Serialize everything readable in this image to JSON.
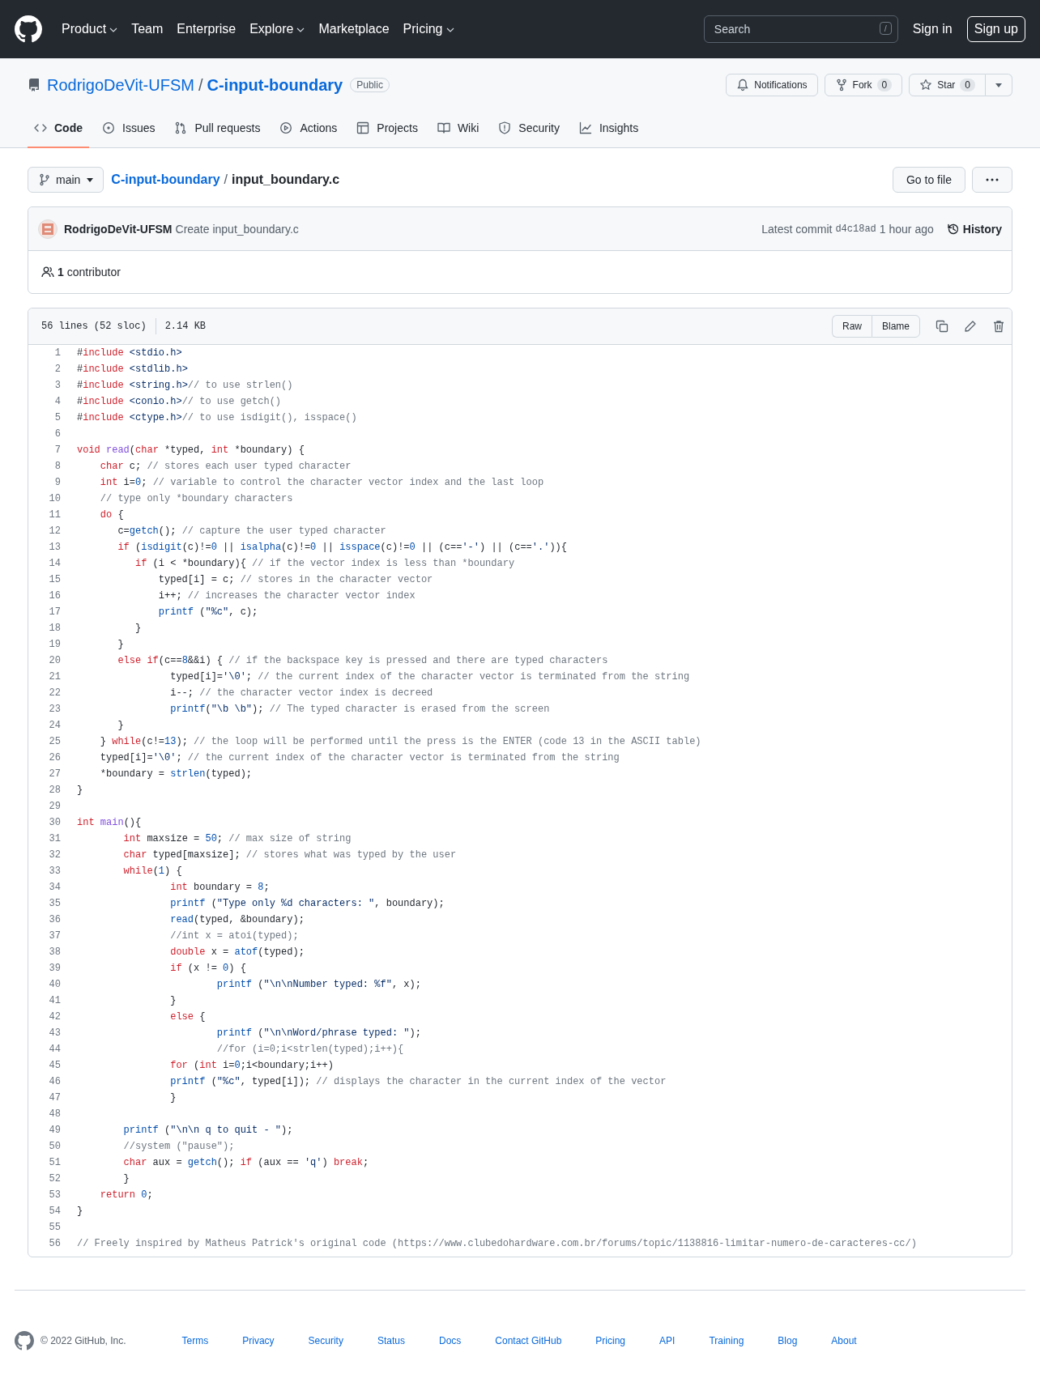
{
  "header": {
    "nav": [
      {
        "label": "Product",
        "dropdown": true
      },
      {
        "label": "Team",
        "dropdown": false
      },
      {
        "label": "Enterprise",
        "dropdown": false
      },
      {
        "label": "Explore",
        "dropdown": true
      },
      {
        "label": "Marketplace",
        "dropdown": false
      },
      {
        "label": "Pricing",
        "dropdown": true
      }
    ],
    "search": {
      "placeholder": "Search",
      "shortcut": "/"
    },
    "sign_in": "Sign in",
    "sign_up": "Sign up"
  },
  "repo": {
    "owner": "RodrigoDeVit-UFSM",
    "separator": "/",
    "name": "C-input-boundary",
    "visibility": "Public",
    "notifications": "Notifications",
    "fork": {
      "label": "Fork",
      "count": "0"
    },
    "star": {
      "label": "Star",
      "count": "0"
    }
  },
  "tabs": [
    {
      "label": "Code",
      "selected": true
    },
    {
      "label": "Issues",
      "selected": false
    },
    {
      "label": "Pull requests",
      "selected": false
    },
    {
      "label": "Actions",
      "selected": false
    },
    {
      "label": "Projects",
      "selected": false
    },
    {
      "label": "Wiki",
      "selected": false
    },
    {
      "label": "Security",
      "selected": false
    },
    {
      "label": "Insights",
      "selected": false
    }
  ],
  "breadcrumb": {
    "branch": "main",
    "repo": "C-input-boundary",
    "separator": "/",
    "file": "input_boundary.c",
    "go_to_file": "Go to file"
  },
  "commit": {
    "author": "RodrigoDeVit-UFSM",
    "message": "Create input_boundary.c",
    "latest_label": "Latest commit",
    "sha": "d4c18ad",
    "time": "1 hour ago",
    "history": "History"
  },
  "contributors": {
    "count": "1",
    "label": "contributor"
  },
  "file": {
    "lines_info": "56 lines (52 sloc)",
    "size": "2.14 KB",
    "buttons": [
      "Raw",
      "Blame"
    ],
    "lines": [
      {
        "n": "1",
        "t": [
          {
            "kind": "plain",
            "text": "#"
          },
          {
            "kind": "keyword",
            "text": "include"
          },
          {
            "kind": "string",
            "text": " <stdio.h>"
          }
        ]
      },
      {
        "n": "2",
        "t": [
          {
            "kind": "plain",
            "text": "#"
          },
          {
            "kind": "keyword",
            "text": "include"
          },
          {
            "kind": "string",
            "text": " <stdlib.h>"
          }
        ]
      },
      {
        "n": "3",
        "t": [
          {
            "kind": "plain",
            "text": "#"
          },
          {
            "kind": "keyword",
            "text": "include"
          },
          {
            "kind": "string",
            "text": " <string.h>"
          },
          {
            "kind": "comment",
            "text": "// to use strlen()"
          }
        ]
      },
      {
        "n": "4",
        "t": [
          {
            "kind": "plain",
            "text": "#"
          },
          {
            "kind": "keyword",
            "text": "include"
          },
          {
            "kind": "string",
            "text": " <conio.h>"
          },
          {
            "kind": "comment",
            "text": "// to use getch()"
          }
        ]
      },
      {
        "n": "5",
        "t": [
          {
            "kind": "plain",
            "text": "#"
          },
          {
            "kind": "keyword",
            "text": "include"
          },
          {
            "kind": "string",
            "text": " <ctype.h>"
          },
          {
            "kind": "comment",
            "text": "// to use isdigit(), isspace()"
          }
        ]
      },
      {
        "n": "6"
      },
      {
        "n": "7",
        "t": [
          {
            "kind": "keyword",
            "text": "void "
          },
          {
            "kind": "def",
            "text": "read"
          },
          {
            "kind": "plain",
            "text": "("
          },
          {
            "kind": "keyword",
            "text": "char"
          },
          {
            "kind": "plain",
            "text": " *typed, "
          },
          {
            "kind": "keyword",
            "text": "int"
          },
          {
            "kind": "plain",
            "text": " *boundary) {"
          }
        ]
      },
      {
        "n": "8",
        "t": [
          {
            "kind": "keyword",
            "text": "    char"
          },
          {
            "kind": "plain",
            "text": " c; "
          },
          {
            "kind": "comment",
            "text": "// stores each user typed character"
          }
        ]
      },
      {
        "n": "9",
        "t": [
          {
            "kind": "keyword",
            "text": "    int"
          },
          {
            "kind": "plain",
            "text": " i="
          },
          {
            "kind": "number",
            "text": "0"
          },
          {
            "kind": "plain",
            "text": "; "
          },
          {
            "kind": "comment",
            "text": "// variable to control the character vector index and the last loop"
          }
        ]
      },
      {
        "n": "10",
        "t": [
          {
            "kind": "comment",
            "text": "    // type only *boundary characters"
          }
        ]
      },
      {
        "n": "11",
        "t": [
          {
            "kind": "keyword",
            "text": "    do"
          },
          {
            "kind": "plain",
            "text": " {"
          }
        ]
      },
      {
        "n": "12",
        "t": [
          {
            "kind": "plain",
            "text": "       c="
          },
          {
            "kind": "call",
            "text": "getch"
          },
          {
            "kind": "plain",
            "text": "(); "
          },
          {
            "kind": "comment",
            "text": "// capture the user typed character"
          }
        ]
      },
      {
        "n": "13",
        "t": [
          {
            "kind": "keyword",
            "text": "       if"
          },
          {
            "kind": "plain",
            "text": " ("
          },
          {
            "kind": "call",
            "text": "isdigit"
          },
          {
            "kind": "plain",
            "text": "(c)!="
          },
          {
            "kind": "number",
            "text": "0"
          },
          {
            "kind": "plain",
            "text": " || "
          },
          {
            "kind": "call",
            "text": "isalpha"
          },
          {
            "kind": "plain",
            "text": "(c)!="
          },
          {
            "kind": "number",
            "text": "0"
          },
          {
            "kind": "plain",
            "text": " || "
          },
          {
            "kind": "call",
            "text": "isspace"
          },
          {
            "kind": "plain",
            "text": "(c)!="
          },
          {
            "kind": "number",
            "text": "0"
          },
          {
            "kind": "plain",
            "text": " || (c=="
          },
          {
            "kind": "string",
            "text": "'-'"
          },
          {
            "kind": "plain",
            "text": ") || (c=="
          },
          {
            "kind": "string",
            "text": "'.'"
          },
          {
            "kind": "plain",
            "text": ")){"
          }
        ]
      },
      {
        "n": "14",
        "t": [
          {
            "kind": "keyword",
            "text": "          if"
          },
          {
            "kind": "plain",
            "text": " (i < *boundary){ "
          },
          {
            "kind": "comment",
            "text": "// if the vector index is less than *boundary"
          }
        ]
      },
      {
        "n": "15",
        "t": [
          {
            "kind": "plain",
            "text": "              typed[i] = c; "
          },
          {
            "kind": "comment",
            "text": "// stores in the character vector"
          }
        ]
      },
      {
        "n": "16",
        "t": [
          {
            "kind": "plain",
            "text": "              i++; "
          },
          {
            "kind": "comment",
            "text": "// increases the character vector index"
          }
        ]
      },
      {
        "n": "17",
        "t": [
          {
            "kind": "call",
            "text": "              printf"
          },
          {
            "kind": "plain",
            "text": " ("
          },
          {
            "kind": "string",
            "text": "\"%c\""
          },
          {
            "kind": "plain",
            "text": ", c);"
          }
        ]
      },
      {
        "n": "18",
        "t": [
          {
            "kind": "plain",
            "text": "          }"
          }
        ]
      },
      {
        "n": "19",
        "t": [
          {
            "kind": "plain",
            "text": "       }"
          }
        ]
      },
      {
        "n": "20",
        "t": [
          {
            "kind": "keyword",
            "text": "       else if"
          },
          {
            "kind": "plain",
            "text": "(c=="
          },
          {
            "kind": "number",
            "text": "8"
          },
          {
            "kind": "plain",
            "text": "&&i) { "
          },
          {
            "kind": "comment",
            "text": "// if the backspace key is pressed and there are typed characters"
          }
        ]
      },
      {
        "n": "21",
        "t": [
          {
            "kind": "plain",
            "text": "                typed[i]="
          },
          {
            "kind": "string",
            "text": "'\\0'"
          },
          {
            "kind": "plain",
            "text": "; "
          },
          {
            "kind": "comment",
            "text": "// the current index of the character vector is terminated from the string"
          }
        ]
      },
      {
        "n": "22",
        "t": [
          {
            "kind": "plain",
            "text": "                i--; "
          },
          {
            "kind": "comment",
            "text": "// the character vector index is decreed"
          }
        ]
      },
      {
        "n": "23",
        "t": [
          {
            "kind": "call",
            "text": "                printf"
          },
          {
            "kind": "plain",
            "text": "("
          },
          {
            "kind": "string",
            "text": "\"\\b \\b\""
          },
          {
            "kind": "plain",
            "text": "); "
          },
          {
            "kind": "comment",
            "text": "// The typed character is erased from the screen"
          }
        ]
      },
      {
        "n": "24",
        "t": [
          {
            "kind": "plain",
            "text": "       }"
          }
        ]
      },
      {
        "n": "25",
        "t": [
          {
            "kind": "plain",
            "text": "    } "
          },
          {
            "kind": "keyword",
            "text": "while"
          },
          {
            "kind": "plain",
            "text": "(c!="
          },
          {
            "kind": "number",
            "text": "13"
          },
          {
            "kind": "plain",
            "text": "); "
          },
          {
            "kind": "comment",
            "text": "// the loop will be performed until the press is the ENTER (code 13 in the ASCII table)"
          }
        ]
      },
      {
        "n": "26",
        "t": [
          {
            "kind": "plain",
            "text": "    typed[i]="
          },
          {
            "kind": "string",
            "text": "'\\0'"
          },
          {
            "kind": "plain",
            "text": "; "
          },
          {
            "kind": "comment",
            "text": "// the current index of the character vector is terminated from the string"
          }
        ]
      },
      {
        "n": "27",
        "t": [
          {
            "kind": "plain",
            "text": "    *boundary = "
          },
          {
            "kind": "call",
            "text": "strlen"
          },
          {
            "kind": "plain",
            "text": "(typed);"
          }
        ]
      },
      {
        "n": "28",
        "t": [
          {
            "kind": "plain",
            "text": "}"
          }
        ]
      },
      {
        "n": "29"
      },
      {
        "n": "30",
        "t": [
          {
            "kind": "keyword",
            "text": "int "
          },
          {
            "kind": "def",
            "text": "main"
          },
          {
            "kind": "plain",
            "text": "(){"
          }
        ]
      },
      {
        "n": "31",
        "t": [
          {
            "kind": "keyword",
            "text": "        int"
          },
          {
            "kind": "plain",
            "text": " maxsize = "
          },
          {
            "kind": "number",
            "text": "50"
          },
          {
            "kind": "plain",
            "text": "; "
          },
          {
            "kind": "comment",
            "text": "// max size of string"
          }
        ]
      },
      {
        "n": "32",
        "t": [
          {
            "kind": "keyword",
            "text": "        char"
          },
          {
            "kind": "plain",
            "text": " typed[maxsize]; "
          },
          {
            "kind": "comment",
            "text": "// stores what was typed by the user"
          }
        ]
      },
      {
        "n": "33",
        "t": [
          {
            "kind": "keyword",
            "text": "        while"
          },
          {
            "kind": "plain",
            "text": "("
          },
          {
            "kind": "number",
            "text": "1"
          },
          {
            "kind": "plain",
            "text": ") {"
          }
        ]
      },
      {
        "n": "34",
        "t": [
          {
            "kind": "keyword",
            "text": "                int"
          },
          {
            "kind": "plain",
            "text": " boundary = "
          },
          {
            "kind": "number",
            "text": "8"
          },
          {
            "kind": "plain",
            "text": ";"
          }
        ]
      },
      {
        "n": "35",
        "t": [
          {
            "kind": "call",
            "text": "                printf"
          },
          {
            "kind": "plain",
            "text": " ("
          },
          {
            "kind": "string",
            "text": "\"Type only %d characters: \""
          },
          {
            "kind": "plain",
            "text": ", boundary);"
          }
        ]
      },
      {
        "n": "36",
        "t": [
          {
            "kind": "call",
            "text": "                read"
          },
          {
            "kind": "plain",
            "text": "(typed, &boundary);"
          }
        ]
      },
      {
        "n": "37",
        "t": [
          {
            "kind": "comment",
            "text": "                //int x = atoi(typed);"
          }
        ]
      },
      {
        "n": "38",
        "t": [
          {
            "kind": "keyword",
            "text": "                double"
          },
          {
            "kind": "plain",
            "text": " x = "
          },
          {
            "kind": "call",
            "text": "atof"
          },
          {
            "kind": "plain",
            "text": "(typed);"
          }
        ]
      },
      {
        "n": "39",
        "t": [
          {
            "kind": "keyword",
            "text": "                if"
          },
          {
            "kind": "plain",
            "text": " (x != "
          },
          {
            "kind": "number",
            "text": "0"
          },
          {
            "kind": "plain",
            "text": ") {"
          }
        ]
      },
      {
        "n": "40",
        "t": [
          {
            "kind": "call",
            "text": "                        printf"
          },
          {
            "kind": "plain",
            "text": " ("
          },
          {
            "kind": "string",
            "text": "\"\\n\\nNumber typed: %f\""
          },
          {
            "kind": "plain",
            "text": ", x);"
          }
        ]
      },
      {
        "n": "41",
        "t": [
          {
            "kind": "plain",
            "text": "                }"
          }
        ]
      },
      {
        "n": "42",
        "t": [
          {
            "kind": "keyword",
            "text": "                else"
          },
          {
            "kind": "plain",
            "text": " {"
          }
        ]
      },
      {
        "n": "43",
        "t": [
          {
            "kind": "call",
            "text": "                        printf"
          },
          {
            "kind": "plain",
            "text": " ("
          },
          {
            "kind": "string",
            "text": "\"\\n\\nWord/phrase typed: \""
          },
          {
            "kind": "plain",
            "text": ");"
          }
        ]
      },
      {
        "n": "44",
        "t": [
          {
            "kind": "comment",
            "text": "                        //for (i=0;i<strlen(typed);i++){"
          }
        ]
      },
      {
        "n": "45",
        "t": [
          {
            "kind": "keyword",
            "text": "                for"
          },
          {
            "kind": "plain",
            "text": " ("
          },
          {
            "kind": "keyword",
            "text": "int"
          },
          {
            "kind": "plain",
            "text": " i="
          },
          {
            "kind": "number",
            "text": "0"
          },
          {
            "kind": "plain",
            "text": ";i<boundary;i++)"
          }
        ]
      },
      {
        "n": "46",
        "t": [
          {
            "kind": "call",
            "text": "                printf"
          },
          {
            "kind": "plain",
            "text": " ("
          },
          {
            "kind": "string",
            "text": "\"%c\""
          },
          {
            "kind": "plain",
            "text": ", typed[i]); "
          },
          {
            "kind": "comment",
            "text": "// displays the character in the current index of the vector"
          }
        ]
      },
      {
        "n": "47",
        "t": [
          {
            "kind": "plain",
            "text": "                }"
          }
        ]
      },
      {
        "n": "48"
      },
      {
        "n": "49",
        "t": [
          {
            "kind": "call",
            "text": "        printf"
          },
          {
            "kind": "plain",
            "text": " ("
          },
          {
            "kind": "string",
            "text": "\"\\n\\n q to quit - \""
          },
          {
            "kind": "plain",
            "text": ");"
          }
        ]
      },
      {
        "n": "50",
        "t": [
          {
            "kind": "comment",
            "text": "        //system (\"pause\");"
          }
        ]
      },
      {
        "n": "51",
        "t": [
          {
            "kind": "keyword",
            "text": "        char"
          },
          {
            "kind": "plain",
            "text": " aux = "
          },
          {
            "kind": "call",
            "text": "getch"
          },
          {
            "kind": "plain",
            "text": "(); "
          },
          {
            "kind": "keyword",
            "text": "if"
          },
          {
            "kind": "plain",
            "text": " (aux == "
          },
          {
            "kind": "string",
            "text": "'q'"
          },
          {
            "kind": "plain",
            "text": ") "
          },
          {
            "kind": "keyword",
            "text": "break"
          },
          {
            "kind": "plain",
            "text": ";"
          }
        ]
      },
      {
        "n": "52",
        "t": [
          {
            "kind": "plain",
            "text": "        }"
          }
        ]
      },
      {
        "n": "53",
        "t": [
          {
            "kind": "keyword",
            "text": "    return"
          },
          {
            "kind": "number",
            "text": " 0"
          },
          {
            "kind": "plain",
            "text": ";"
          }
        ]
      },
      {
        "n": "54",
        "t": [
          {
            "kind": "plain",
            "text": "}"
          }
        ]
      },
      {
        "n": "55"
      },
      {
        "n": "56",
        "t": [
          {
            "kind": "comment",
            "text": "// Freely inspired by Matheus Patrick's original code (https://www.clubedohardware.com.br/forums/topic/1138816-limitar-numero-de-caracteres-cc/)"
          }
        ]
      }
    ]
  },
  "footer": {
    "copyright": "© 2022 GitHub, Inc.",
    "links": [
      "Terms",
      "Privacy",
      "Security",
      "Status",
      "Docs",
      "Contact GitHub",
      "Pricing",
      "API",
      "Training",
      "Blog",
      "About"
    ]
  }
}
